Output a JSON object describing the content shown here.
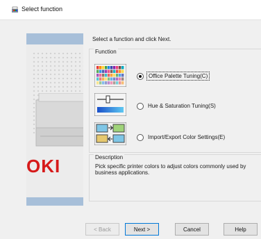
{
  "window": {
    "title": "Select function",
    "icon": "printer-color-icon"
  },
  "instruction": "Select a function and click Next.",
  "function_group": {
    "label": "Function",
    "options": [
      {
        "label": "Office Palette Tuning(C)",
        "selected": true,
        "icon": "color-palette-icon"
      },
      {
        "label": "Hue & Saturation Tuning(S)",
        "selected": false,
        "icon": "hue-slider-icon"
      },
      {
        "label": "Import/Export Color Settings(E)",
        "selected": false,
        "icon": "import-export-icon"
      }
    ]
  },
  "description": {
    "label": "Description",
    "text": "Pick specific printer colors to adjust colors commonly used by business applications."
  },
  "brand": {
    "logo_text": "OKI",
    "color": "#d61a1a"
  },
  "buttons": {
    "back": "< Back",
    "next": "Next >",
    "cancel": "Cancel",
    "help": "Help"
  },
  "colors": {
    "panel_band": "#a7bfd9",
    "focus_border": "#0078d7"
  }
}
